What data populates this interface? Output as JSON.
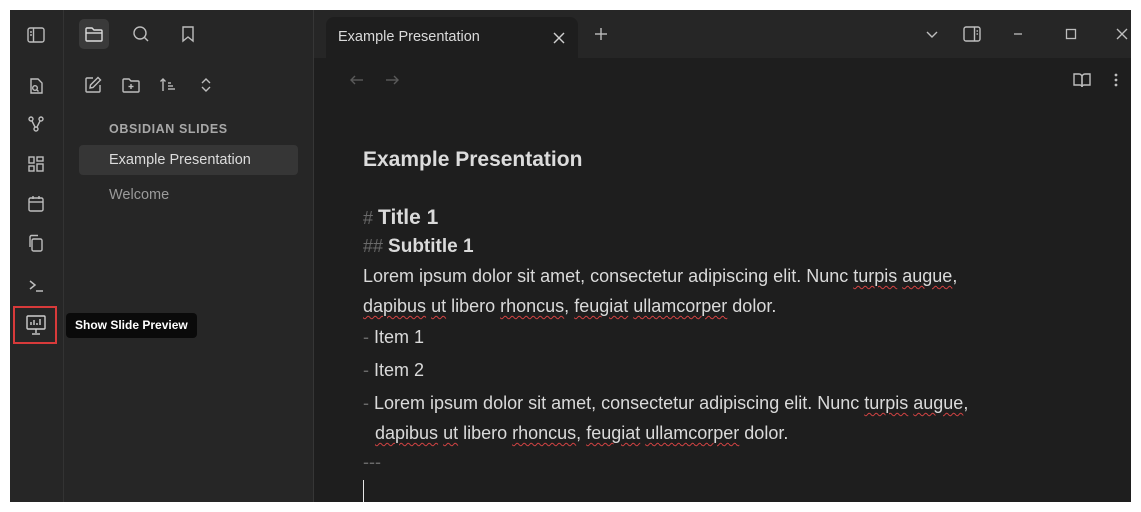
{
  "window": {
    "tab_title": "Example Presentation"
  },
  "ribbon": {
    "items": [
      {
        "name": "open-quick-switcher-icon"
      },
      {
        "name": "graph-view-icon"
      },
      {
        "name": "canvas-icon"
      },
      {
        "name": "daily-note-icon"
      },
      {
        "name": "templates-icon"
      },
      {
        "name": "command-palette-icon"
      },
      {
        "name": "slide-preview-icon"
      }
    ],
    "tooltip": "Show Slide Preview"
  },
  "sidebar": {
    "vault_name": "OBSIDIAN SLIDES",
    "files": [
      {
        "label": "Example Presentation",
        "active": true
      },
      {
        "label": "Welcome",
        "active": false
      }
    ]
  },
  "editor": {
    "inline_title": "Example Presentation",
    "h1_marker": "#",
    "h1_text": "Title 1",
    "h2_marker": "##",
    "h2_text": "Subtitle 1",
    "para": {
      "l1_a": "Lorem ipsum dolor sit amet, consectetur adipiscing elit. Nunc ",
      "turpis": "turpis",
      "augue": "augue",
      "l2_dapibus": "dapibus",
      "ut": "ut",
      "libero": " libero ",
      "rhoncus": "rhoncus",
      "feugiat": "feugiat",
      "ullamcorper": "ullamcorper",
      "dolor": " dolor."
    },
    "list_marker": "-",
    "item1": "Item 1",
    "item2": "Item 2",
    "separator": "---"
  },
  "colors": {
    "accent_highlight": "#d83a3a",
    "spellcheck": "#d24343"
  }
}
